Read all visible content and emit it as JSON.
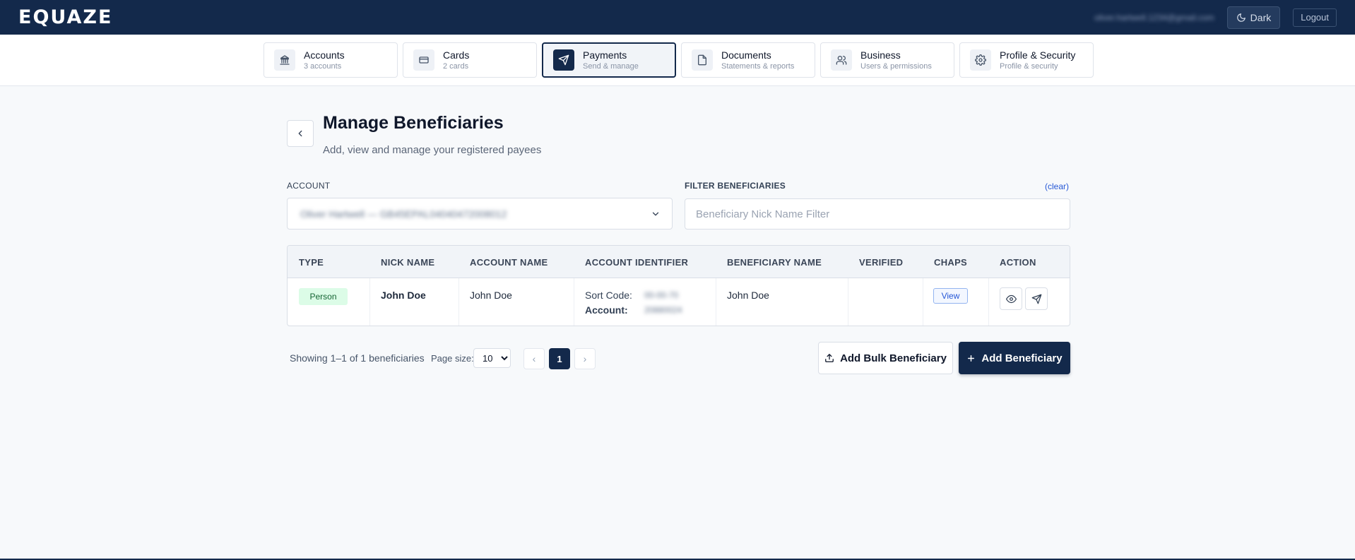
{
  "header": {
    "logo": "EQUAZE",
    "user_email": "oliver.hartwell.1234@gmail.com",
    "theme_button": "Dark",
    "logout_button": "Logout"
  },
  "nav": {
    "tabs": [
      {
        "label": "Accounts",
        "sub": "3 accounts",
        "icon": "bank-icon",
        "active": false
      },
      {
        "label": "Cards",
        "sub": "2 cards",
        "icon": "card-icon",
        "active": false
      },
      {
        "label": "Payments",
        "sub": "Send & manage",
        "icon": "send-icon",
        "active": true
      },
      {
        "label": "Documents",
        "sub": "Statements & reports",
        "icon": "document-icon",
        "active": false
      },
      {
        "label": "Business",
        "sub": "Users & permissions",
        "icon": "users-icon",
        "active": false
      },
      {
        "label": "Profile & Security",
        "sub": "Profile & security",
        "icon": "gear-icon",
        "active": false
      }
    ]
  },
  "page": {
    "title": "Manage Beneficiaries",
    "subtitle": "Add, view and manage your registered payees"
  },
  "filters": {
    "account_label": "ACCOUNT",
    "account_value": "Oliver Hartwell — GB45EPAL04040472008012",
    "filter_label": "FILTER BENEFICIARIES",
    "clear_link": "(clear)",
    "filter_placeholder": "Beneficiary Nick Name Filter"
  },
  "table": {
    "columns": [
      "TYPE",
      "NICK NAME",
      "ACCOUNT NAME",
      "ACCOUNT IDENTIFIER",
      "BENEFICIARY NAME",
      "VERIFIED",
      "CHAPS",
      "ACTION"
    ],
    "rows": [
      {
        "type": "Person",
        "nick_name": "John Doe",
        "account_name": "John Doe",
        "sort_code_label": "Sort Code:",
        "sort_code": "00-00-70",
        "account_label": "Account:",
        "account_number": "20880024",
        "beneficiary_name": "John Doe",
        "verified": "",
        "chaps_button": "View"
      }
    ]
  },
  "footer": {
    "showing": "Showing 1–1 of 1 beneficiaries",
    "page_size_label": "Page size:",
    "page_size": "10",
    "prev": "‹",
    "current_page": "1",
    "next": "›",
    "bulk_button": "Add Bulk Beneficiary",
    "add_button": "Add Beneficiary"
  },
  "colors": {
    "brand_navy": "#13294b",
    "accent_blue": "#2557d6",
    "badge_green_bg": "#dcfce7",
    "badge_green_text": "#166534"
  }
}
